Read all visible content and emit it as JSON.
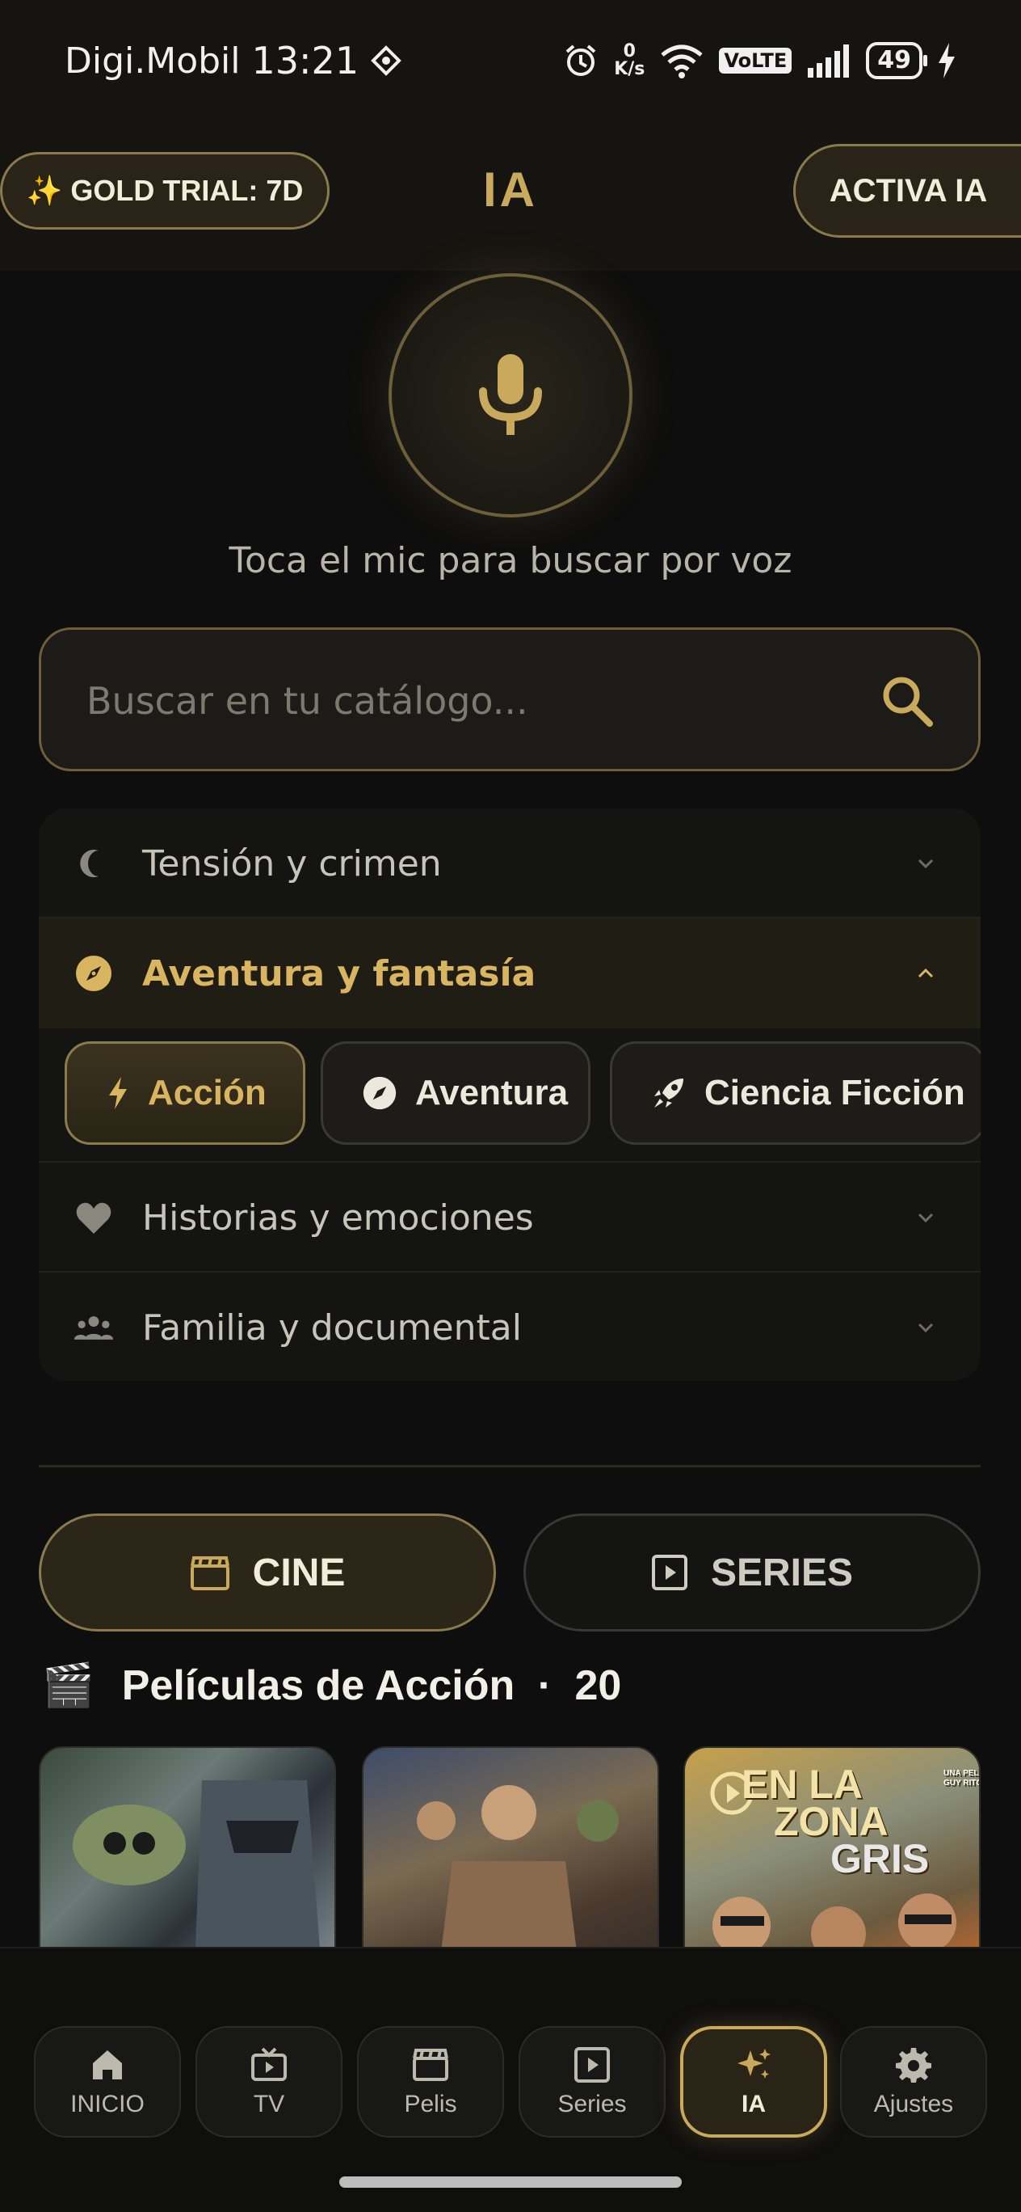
{
  "status_bar": {
    "carrier": "Digi.Mobil",
    "time": "13:21",
    "net_speed_value": "0",
    "net_speed_unit": "K/s",
    "signal_label": "6",
    "volte": "VoLTE",
    "battery": "49"
  },
  "header": {
    "trial_badge": "✨ GOLD TRIAL: 7D",
    "title": "IA",
    "activate_button": "ACTIVA IA"
  },
  "voice": {
    "hint": "Toca el mic para buscar por voz"
  },
  "search": {
    "placeholder": "Buscar en tu catálogo...",
    "value": ""
  },
  "categories": [
    {
      "label": "Tensión y crimen",
      "icon": "moon-icon",
      "expanded": false
    },
    {
      "label": "Aventura y fantasía",
      "icon": "compass-icon",
      "expanded": true
    },
    {
      "label": "Historias y emociones",
      "icon": "heart-icon",
      "expanded": false
    },
    {
      "label": "Familia y documental",
      "icon": "people-icon",
      "expanded": false
    }
  ],
  "genre_chips": [
    {
      "label": "Acción",
      "icon": "bolt-icon",
      "active": true
    },
    {
      "label": "Aventura",
      "icon": "compass-icon",
      "active": false
    },
    {
      "label": "Ciencia Ficción",
      "icon": "rocket-icon",
      "active": false
    }
  ],
  "content_toggle": {
    "cine": "CINE",
    "series": "SERIES",
    "selected": "CINE"
  },
  "section": {
    "emoji": "🎬",
    "title": "Películas de Acción",
    "separator": "·",
    "count": "20"
  },
  "posters": [
    {
      "title": ""
    },
    {
      "title": ""
    },
    {
      "title_line1": "EN LA",
      "title_line2": "ZONA",
      "title_line3": "GRIS",
      "tagline": "UNA PELÍCULA DE GUY RITCHIE"
    }
  ],
  "bottom_nav": [
    {
      "label": "INICIO",
      "icon": "home-icon",
      "active": false
    },
    {
      "label": "TV",
      "icon": "tv-icon",
      "active": false
    },
    {
      "label": "Pelis",
      "icon": "clapperboard-icon",
      "active": false
    },
    {
      "label": "Series",
      "icon": "play-square-icon",
      "active": false
    },
    {
      "label": "IA",
      "icon": "sparkles-icon",
      "active": true
    },
    {
      "label": "Ajustes",
      "icon": "gear-icon",
      "active": false
    }
  ],
  "colors": {
    "accent_gold": "#c9a95c",
    "background": "#0e0e0e",
    "header_bg": "#161410"
  }
}
